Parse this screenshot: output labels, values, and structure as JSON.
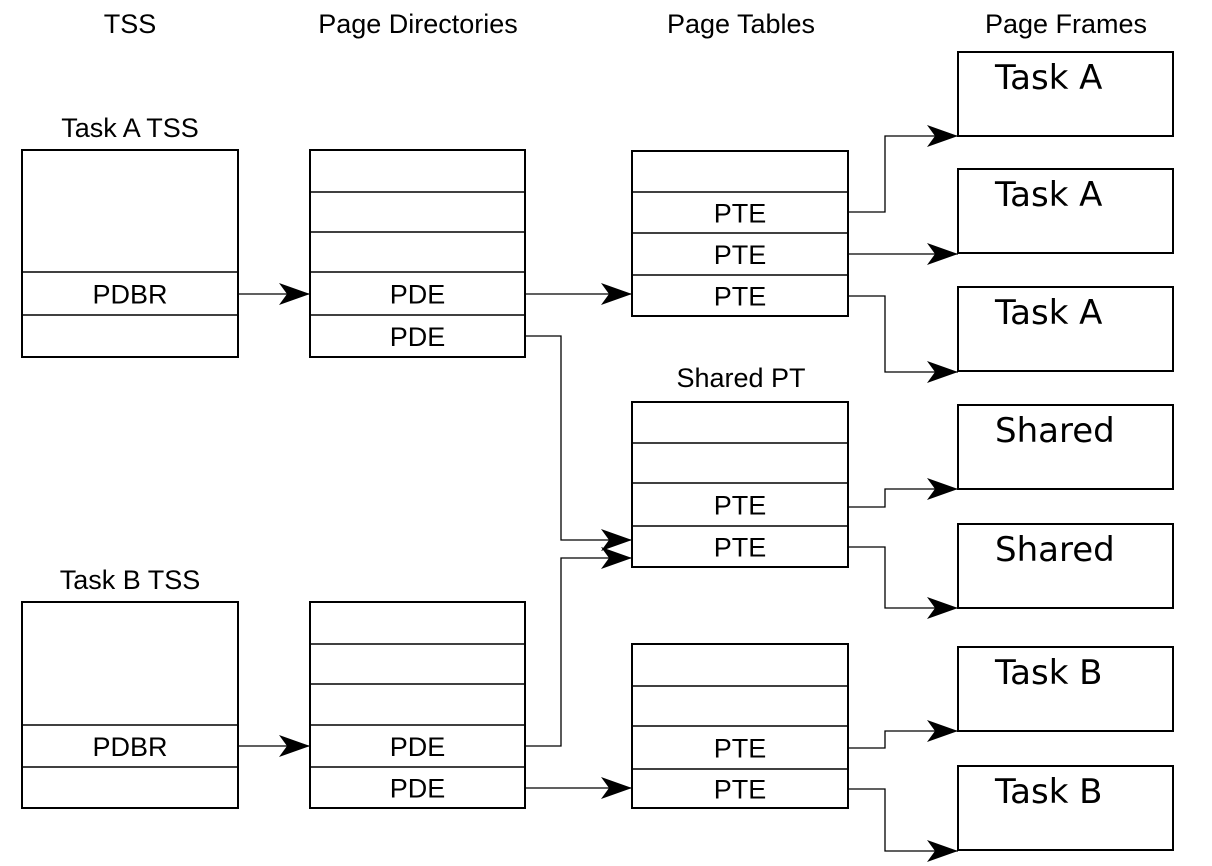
{
  "headers": {
    "tss": "TSS",
    "page_directories": "Page Directories",
    "page_tables": "Page Tables",
    "page_frames": "Page Frames"
  },
  "tss_a": {
    "label": "Task A TSS",
    "entry": "PDBR"
  },
  "tss_b": {
    "label": "Task B TSS",
    "entry": "PDBR"
  },
  "pd_a": {
    "entries": [
      "",
      "",
      "",
      "PDE",
      "PDE"
    ]
  },
  "pd_b": {
    "entries": [
      "",
      "",
      "",
      "PDE",
      "PDE"
    ]
  },
  "pt_a": {
    "entries": [
      "",
      "PTE",
      "PTE",
      "PTE"
    ]
  },
  "pt_shared": {
    "label": "Shared PT",
    "entries": [
      "",
      "",
      "PTE",
      "PTE"
    ]
  },
  "pt_b": {
    "entries": [
      "",
      "",
      "PTE",
      "PTE"
    ]
  },
  "frames": [
    "Task A",
    "Task A",
    "Task A",
    "Shared",
    "Shared",
    "Task B",
    "Task B"
  ]
}
